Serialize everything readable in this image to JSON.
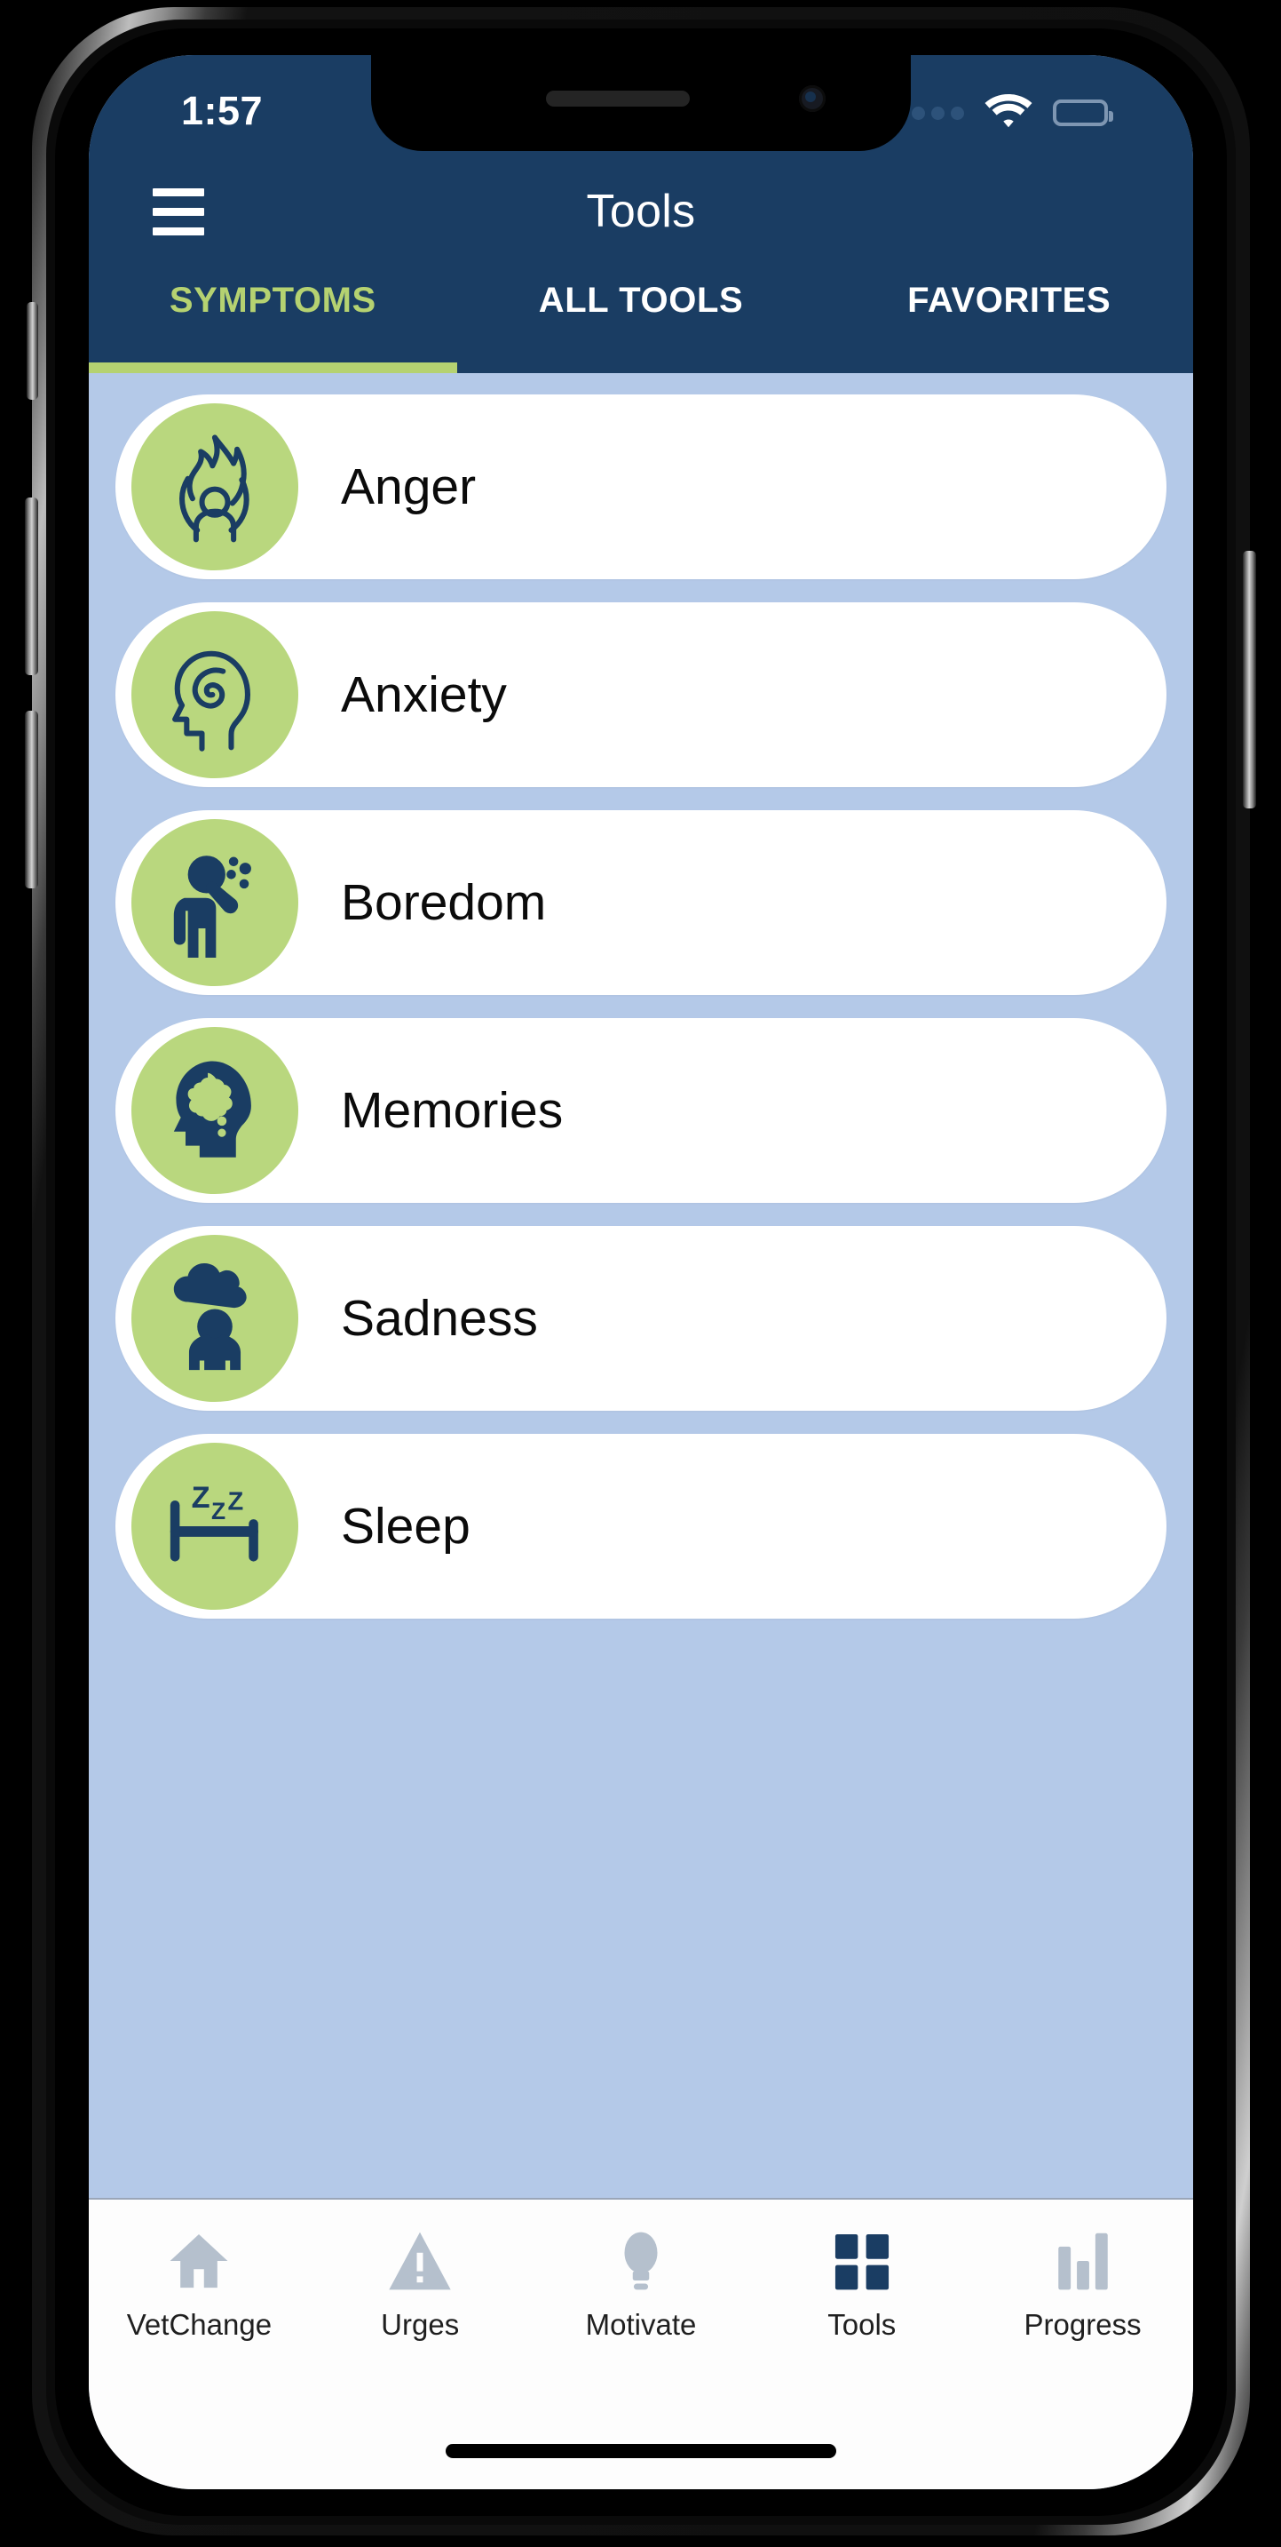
{
  "status_bar": {
    "time": "1:57",
    "signal_icon": "signal-dots-icon",
    "wifi_icon": "wifi-icon",
    "battery_icon": "battery-full-icon"
  },
  "nav": {
    "menu_icon": "hamburger-menu-icon",
    "title": "Tools"
  },
  "tabs": [
    {
      "label": "SYMPTOMS",
      "active": true
    },
    {
      "label": "ALL TOOLS",
      "active": false
    },
    {
      "label": "FAVORITES",
      "active": false
    }
  ],
  "symptoms": [
    {
      "label": "Anger",
      "icon": "flame-person-icon"
    },
    {
      "label": "Anxiety",
      "icon": "head-spiral-icon"
    },
    {
      "label": "Boredom",
      "icon": "person-sighing-icon"
    },
    {
      "label": "Memories",
      "icon": "head-thought-bubble-icon"
    },
    {
      "label": "Sadness",
      "icon": "rain-cloud-person-icon"
    },
    {
      "label": "Sleep",
      "icon": "bed-zzz-icon"
    }
  ],
  "bottom_nav": [
    {
      "label": "VetChange",
      "icon": "home-icon",
      "active": false
    },
    {
      "label": "Urges",
      "icon": "warning-icon",
      "active": false
    },
    {
      "label": "Motivate",
      "icon": "lightbulb-icon",
      "active": false
    },
    {
      "label": "Tools",
      "icon": "grid-icon",
      "active": true
    },
    {
      "label": "Progress",
      "icon": "bar-chart-icon",
      "active": false
    }
  ],
  "colors": {
    "header_navy": "#1a3d63",
    "accent_green": "#b5d271",
    "icon_circle_green": "#b9d77e",
    "screen_background": "#b4c9e8",
    "card_white": "#ffffff",
    "icon_navy": "#1a3d63",
    "inactive_tabbar": "#b5c0cd"
  }
}
